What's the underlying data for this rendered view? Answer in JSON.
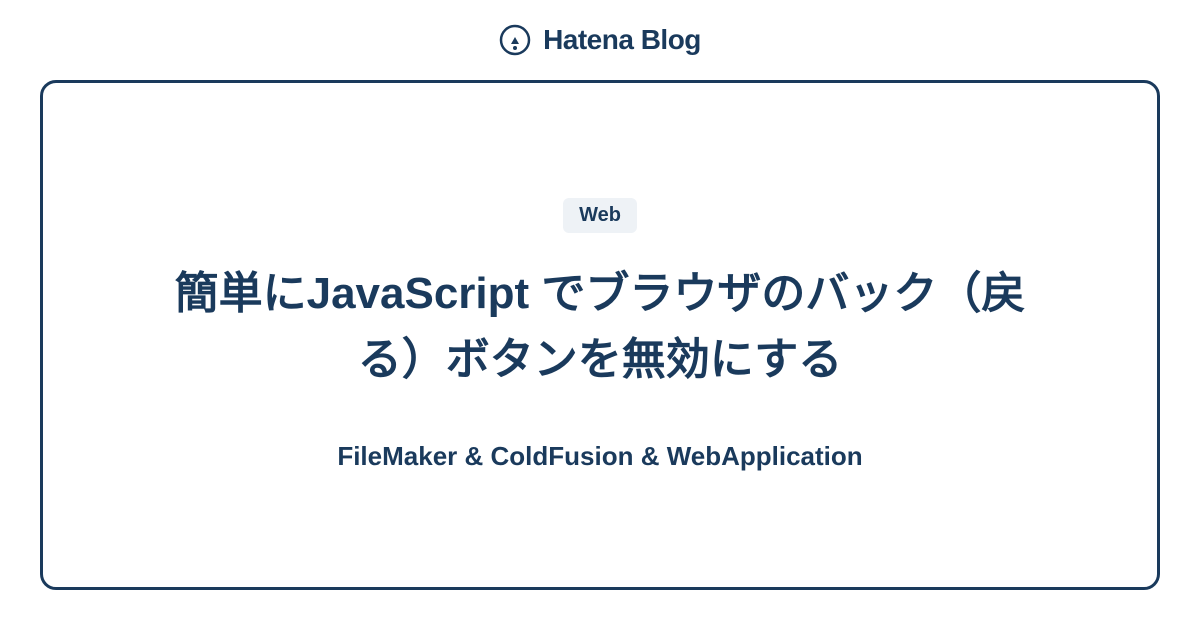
{
  "header": {
    "brand": "Hatena Blog"
  },
  "card": {
    "badge": "Web",
    "title": "簡単にJavaScript でブラウザのバック（戻る）ボタンを無効にする",
    "subtitle": "FileMaker & ColdFusion & WebApplication"
  }
}
